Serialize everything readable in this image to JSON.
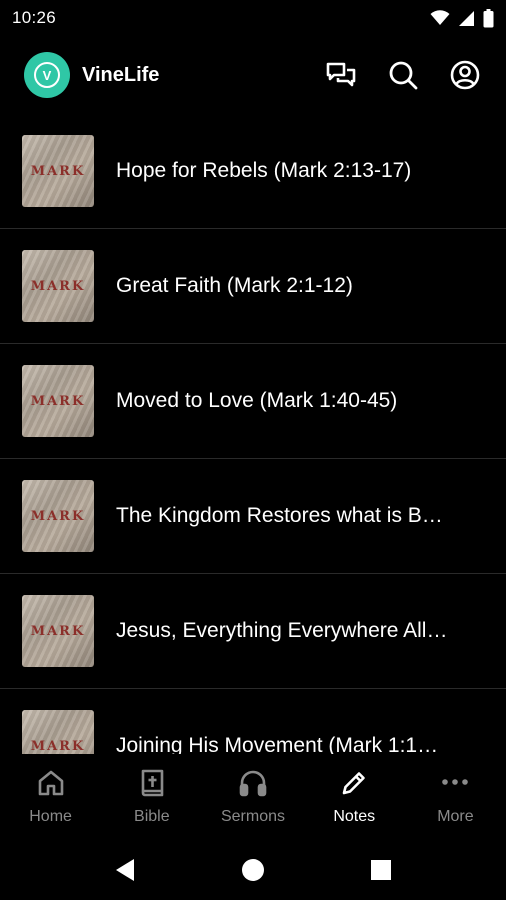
{
  "status": {
    "time": "10:26"
  },
  "header": {
    "app_name": "VineLife",
    "logo_letter": "V"
  },
  "sermons": [
    {
      "thumb_text": "MARK",
      "title": "Hope for Rebels (Mark 2:13-17)"
    },
    {
      "thumb_text": "MARK",
      "title": "Great Faith (Mark 2:1-12)"
    },
    {
      "thumb_text": "MARK",
      "title": "Moved to Love (Mark 1:40-45)"
    },
    {
      "thumb_text": "MARK",
      "title": "The Kingdom Restores what is B…"
    },
    {
      "thumb_text": "MARK",
      "title": "Jesus, Everything Everywhere All…"
    },
    {
      "thumb_text": "MARK",
      "title": "Joining His Movement (Mark 1:1…"
    }
  ],
  "nav": {
    "items": [
      {
        "label": "Home",
        "icon": "home-icon"
      },
      {
        "label": "Bible",
        "icon": "bible-icon"
      },
      {
        "label": "Sermons",
        "icon": "headphones-icon"
      },
      {
        "label": "Notes",
        "icon": "pencil-icon"
      },
      {
        "label": "More",
        "icon": "more-icon"
      }
    ],
    "active": "Notes"
  },
  "colors": {
    "accent": "#2fc7a6",
    "background": "#000000",
    "inactive": "#8a8a8a",
    "thumb_text": "#8b2f2a"
  }
}
